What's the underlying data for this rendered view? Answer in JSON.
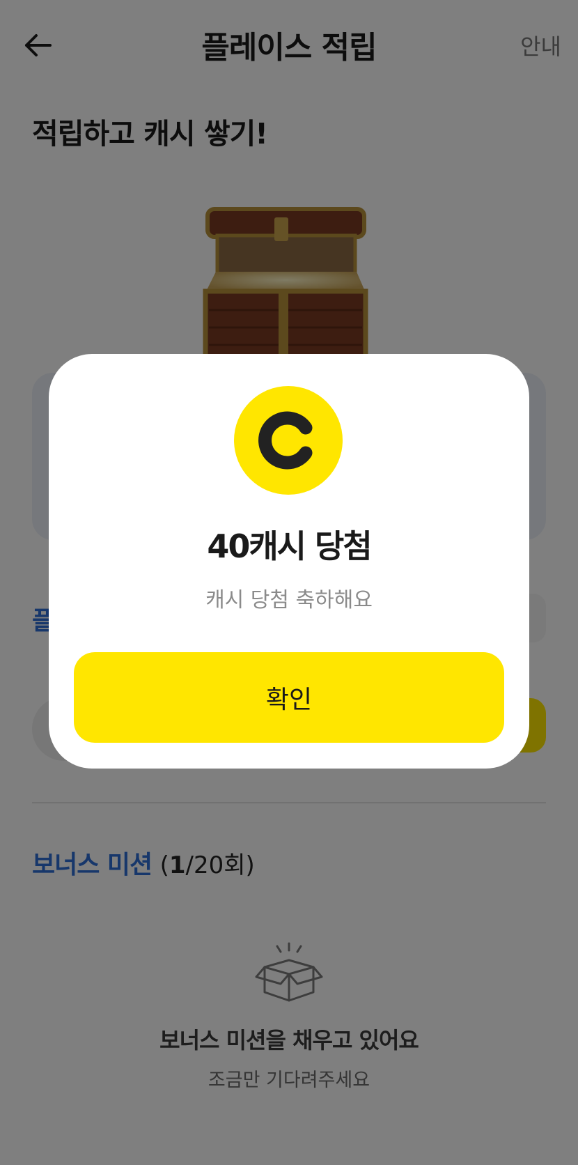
{
  "header": {
    "title": "플레이스 적립",
    "guide_label": "안내"
  },
  "hero": {
    "heading": "적립하고 캐시 쌓기!"
  },
  "section_peek": "플",
  "bonus": {
    "title": "보너스 미션",
    "count_open": "(",
    "count_current": "1",
    "count_rest": "/20회)"
  },
  "empty_state": {
    "title": "보너스 미션을 채우고 있어요",
    "subtitle": "조금만 기다려주세요"
  },
  "modal": {
    "title": "40캐시 당첨",
    "subtitle": "캐시 당첨 축하해요",
    "confirm_label": "확인"
  },
  "colors": {
    "accent_yellow": "#ffe600",
    "accent_blue": "#2f6ed6",
    "overlay": "rgba(0,0,0,0.5)"
  },
  "icons": {
    "back": "arrow-left-icon",
    "chest": "treasure-chest-icon",
    "coin": "cash-coin-icon",
    "empty": "open-box-icon"
  }
}
